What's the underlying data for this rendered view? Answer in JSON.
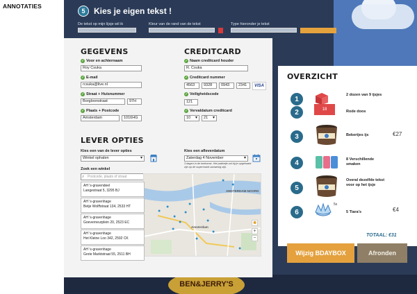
{
  "page_label": "ANNOTATIES",
  "background": {
    "step_number": "5",
    "title": "Kies je eigen tekst !",
    "labels": [
      "De tekst op mijn lijsje wil ik",
      "Kleur van de rand van de tekst",
      "Type hieronder je tekst"
    ]
  },
  "gegevens": {
    "title": "GEGEVENS",
    "name_label": "Voor en achternaam",
    "name_value": "Roy Csuka",
    "email_label": "E-mail",
    "email_value": "rcsuka@live.nl",
    "street_label": "Straat + Huisnummer",
    "street_value": "Borgloonstraat",
    "house_value": "97H",
    "city_label": "Plaats + Postcode",
    "city_value": "Amsterdam",
    "postcode_value": "1016HG"
  },
  "creditcard": {
    "title": "CREDITCARD",
    "holder_label": "Naam creditcard houder",
    "holder_value": "R. Csuka",
    "number_label": "Creditcard nummer",
    "number_parts": [
      "4563",
      "9328",
      "0943",
      "2341"
    ],
    "card_brand": "VISA",
    "cvc_label": "Veiligheidscode",
    "cvc_value": "121",
    "expiry_label": "Vervaldatum creditcard",
    "expiry_month": "10",
    "expiry_year": "21"
  },
  "lever": {
    "title": "LEVER OPTIES",
    "option_label": "Kies een van de lever opties",
    "option_value": "Winkel ophalen",
    "date_label": "Kies een afleverdatum",
    "date_value": "Zaterdag 4 November",
    "date_note": "3 dagen in de toekomst. Het pakketje zal bij je opgehaald zijn op de supermarkt aanwezig zijn.",
    "store_search_label": "Zoek een winkel",
    "store_search_placeholder": "Postcode, plaats of straat",
    "stores": [
      {
        "name": "AH 's-gravendeel",
        "address": "Langestraat 5, 3295 BJ"
      },
      {
        "name": "AH 's-gravenhage",
        "address": "Betje Wolffstraat 134, 2533 HT"
      },
      {
        "name": "AH 's-gravenhage",
        "address": "Goeverneurplein 20, 2523 EC"
      },
      {
        "name": "AH 's-gravenhage",
        "address": "Het Kleine Loo 342, 2592 CK"
      },
      {
        "name": "AH 's-gravenhage",
        "address": "Grote Marktstraat 55, 2511 BH"
      }
    ],
    "map_labels": [
      "Amsterdam",
      "AMSTERDAM-NOORD"
    ]
  },
  "overzicht": {
    "title": "OVERZICHT",
    "items": [
      {
        "number": "1",
        "text": "2 dozen van 9 ijsjes",
        "price": ""
      },
      {
        "number": "2",
        "text": "Rode doos",
        "price": ""
      },
      {
        "number": "3",
        "text": "Bekertjes ijs",
        "price": "€27"
      },
      {
        "number": "4",
        "text": "8 Verschillende smaken",
        "price": ""
      },
      {
        "number": "5",
        "text": "Overal dezelfde tekst voor op het ijsje",
        "price": ""
      },
      {
        "number": "6",
        "text": "5 Tiara's",
        "price": "€4"
      }
    ],
    "box_number": "18",
    "tiara_count": "5x",
    "total": "TOTAAL: €31",
    "btn_edit": "Wijzig BDAYBOX",
    "btn_finish": "Afronden"
  },
  "colors": {
    "accent_orange": "#e4a13e",
    "finish_brown": "#8f7f66",
    "step_blue": "#2a6b8c",
    "check_green": "#5aa33c"
  }
}
